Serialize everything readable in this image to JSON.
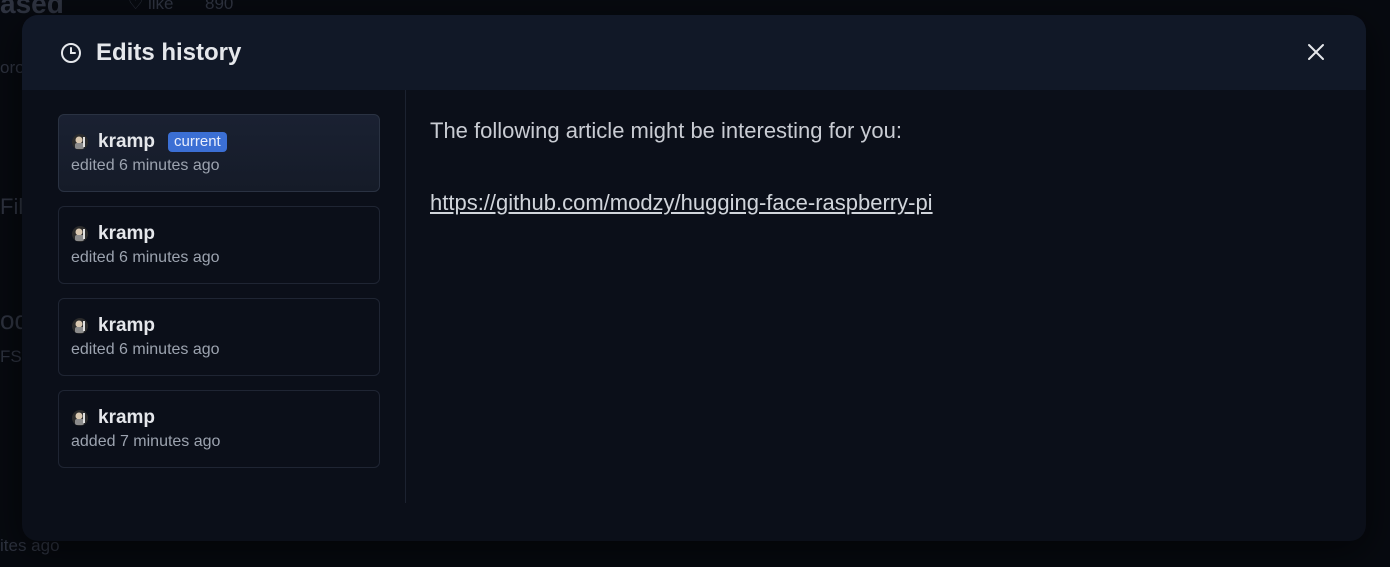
{
  "background": {
    "title_fragment": "ased",
    "like_label": "like",
    "like_count": "890",
    "side_fragment_1": "oro",
    "side_fragment_2": "Fil",
    "side_fragment_3": "od",
    "side_fragment_4": "FS",
    "footer_fragment": "ites ago"
  },
  "modal": {
    "title": "Edits history",
    "title_icon": "clock-icon",
    "close_icon": "close-icon"
  },
  "edits": [
    {
      "user": "kramp",
      "badge": "current",
      "meta": "edited 6 minutes ago",
      "active": true
    },
    {
      "user": "kramp",
      "meta": "edited 6 minutes ago"
    },
    {
      "user": "kramp",
      "meta": "edited 6 minutes ago"
    },
    {
      "user": "kramp",
      "meta": "added 7 minutes ago"
    }
  ],
  "content": {
    "text": "The following article might be interesting for you:",
    "link": "https://github.com/modzy/hugging-face-raspberry-pi"
  },
  "colors": {
    "badge": "#3b6fd4",
    "modal_bg": "#0b0f19",
    "header_bg": "#111827"
  }
}
